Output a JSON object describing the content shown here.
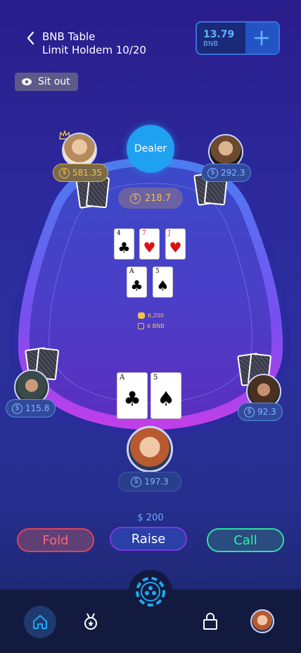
{
  "header": {
    "table_name": "BNB Table",
    "table_type": "Limit Holdem 10/20",
    "balance_amount": "13.79",
    "balance_currency": "BNB"
  },
  "sit_out_label": "Sit out",
  "dealer_label": "Dealer",
  "pot": "218.7",
  "table_stats": {
    "chips": "6,200",
    "bnb": "6 BNB"
  },
  "players": [
    {
      "seat": "top-left",
      "stack": "581.35",
      "dealer_crown": true
    },
    {
      "seat": "top-right",
      "stack": "292.3"
    },
    {
      "seat": "mid-left",
      "stack": "115.8"
    },
    {
      "seat": "mid-right",
      "stack": "92.3"
    },
    {
      "seat": "hero",
      "stack": "197.3"
    }
  ],
  "community_cards": [
    {
      "rank": "4",
      "suit": "♣"
    },
    {
      "rank": "7",
      "suit": "♥"
    },
    {
      "rank": "J",
      "suit": "♥"
    },
    {
      "rank": "A",
      "suit": "♣"
    },
    {
      "rank": "5",
      "suit": "♠"
    }
  ],
  "hero_cards": [
    {
      "rank": "A",
      "suit": "♣"
    },
    {
      "rank": "5",
      "suit": "♠"
    }
  ],
  "actions": {
    "raise_amount": "$ 200",
    "fold_label": "Fold",
    "raise_label": "Raise",
    "call_label": "Call"
  },
  "colors": {
    "accent_blue": "#20a0f0",
    "fold": "#e2415a",
    "raise": "#7b38e0",
    "call": "#2ee0a2",
    "chip_gold": "#f3c14a"
  },
  "nav": {
    "items": [
      "home-icon",
      "medal-icon",
      "chip-icon",
      "lock-icon",
      "profile-avatar"
    ]
  }
}
